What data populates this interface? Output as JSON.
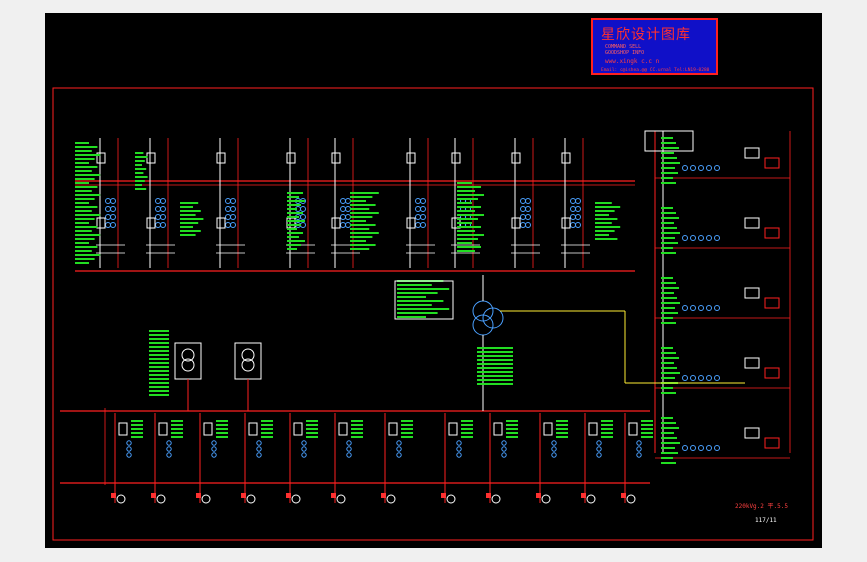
{
  "stamp": {
    "title": "星欣设计图库",
    "subtitle_1": "COMMAND SELL",
    "subtitle_2": "GOODSHOP INFO",
    "website": "www.xingk c.c n",
    "email": "Email: c@ishea.@@ CC.urnal Tel:LN19-0280"
  },
  "drawing": {
    "note": "220kVg.2 平.5.5",
    "number": "117/11"
  },
  "colors": {
    "background": "#000000",
    "frame": "#ff2020",
    "bus": "#ff2020",
    "equipment": "#ffffff",
    "labels_bg": "#22dd22",
    "feeder_line": "#ffee33",
    "stamp_bg": "#1010c8",
    "stamp_border": "#ff2020",
    "stamp_text": "#ff3030"
  }
}
